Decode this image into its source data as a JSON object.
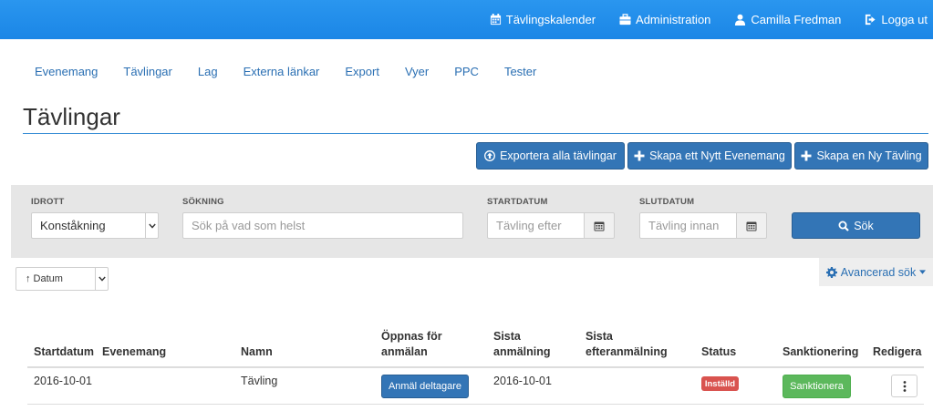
{
  "topnav": {
    "calendar": "Tävlingskalender",
    "admin": "Administration",
    "user": "Camilla Fredman",
    "logout": "Logga ut"
  },
  "mainnav": [
    "Evenemang",
    "Tävlingar",
    "Lag",
    "Externa länkar",
    "Export",
    "Vyer",
    "PPC",
    "Tester"
  ],
  "page": {
    "title": "Tävlingar"
  },
  "actions": {
    "export": "Exportera alla tävlingar",
    "new_event": "Skapa ett Nytt Evenemang",
    "new_competition": "Skapa en Ny Tävling"
  },
  "filters": {
    "sport_label": "IDROTT",
    "sport_value": "Konståkning",
    "search_label": "SÖKNING",
    "search_placeholder": "Sök på vad som helst",
    "start_label": "STARTDATUM",
    "start_placeholder": "Tävling efter",
    "end_label": "SLUTDATUM",
    "end_placeholder": "Tävling innan",
    "search_button": "Sök"
  },
  "sort": {
    "value": "↑ Datum"
  },
  "advanced": {
    "label": "Avancerad sök"
  },
  "table": {
    "headers": {
      "start": "Startdatum",
      "event": "Evenemang",
      "name": "Namn",
      "opens_1": "Öppnas för",
      "opens_2": "anmälan",
      "last_1": "Sista",
      "last_2": "anmälning",
      "late_1": "Sista",
      "late_2": "efteranmälning",
      "status": "Status",
      "sanction": "Sanktionering",
      "edit": "Redigera"
    },
    "rows": [
      {
        "start": "2016-10-01",
        "event": "",
        "name": "Tävling",
        "register_button": "Anmäl deltagare",
        "last": "2016-10-01",
        "late": "",
        "status": "Inställd",
        "sanction_button": "Sanktionera"
      }
    ]
  },
  "colors": {
    "topbar": "#1b86e6",
    "primary": "#3375b6",
    "danger": "#d9534f",
    "success": "#5cb85c",
    "link": "#2a6fb3"
  }
}
